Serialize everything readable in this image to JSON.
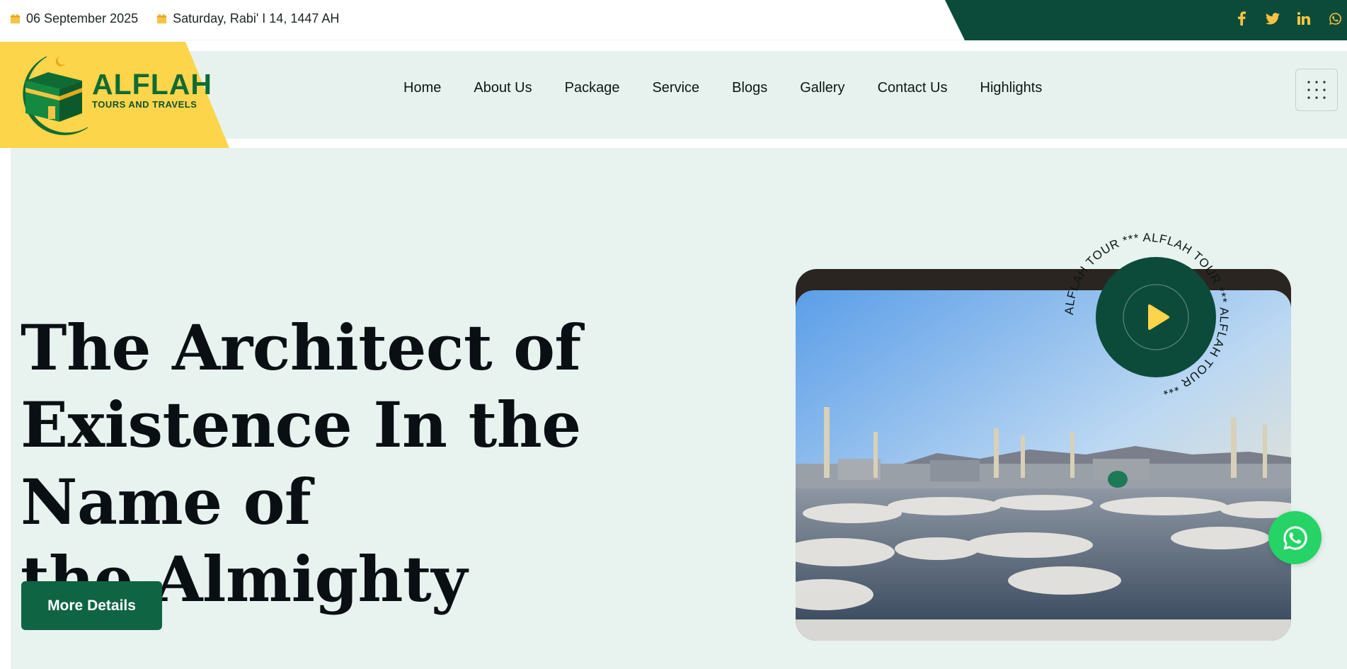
{
  "topbar": {
    "gregorian_date": "06 September 2025",
    "hijri_date": "Saturday, Rabi' I 14, 1447 AH",
    "social": [
      "facebook-icon",
      "twitter-icon",
      "linkedin-icon",
      "whatsapp-icon"
    ]
  },
  "brand": {
    "name": "ALFLAH",
    "tagline": "TOURS AND TRAVELS"
  },
  "nav": {
    "items": [
      "Home",
      "About Us",
      "Package",
      "Service",
      "Blogs",
      "Gallery",
      "Contact Us",
      "Highlights"
    ]
  },
  "hero": {
    "headline_line1": "The Architect of",
    "headline_line2": "Existence In the Name of",
    "headline_line3": "the Almighty",
    "cta_label": "More Details",
    "badge_text": "ALFLAH TOUR *** ALFLAH TOUR *** ALFLAH TOUR *** "
  },
  "colors": {
    "brand_green": "#0c4b3a",
    "accent_yellow": "#fdd54a",
    "hero_bg": "#e8f2ef",
    "button_green": "#0f6444",
    "whatsapp_green": "#25d366"
  }
}
